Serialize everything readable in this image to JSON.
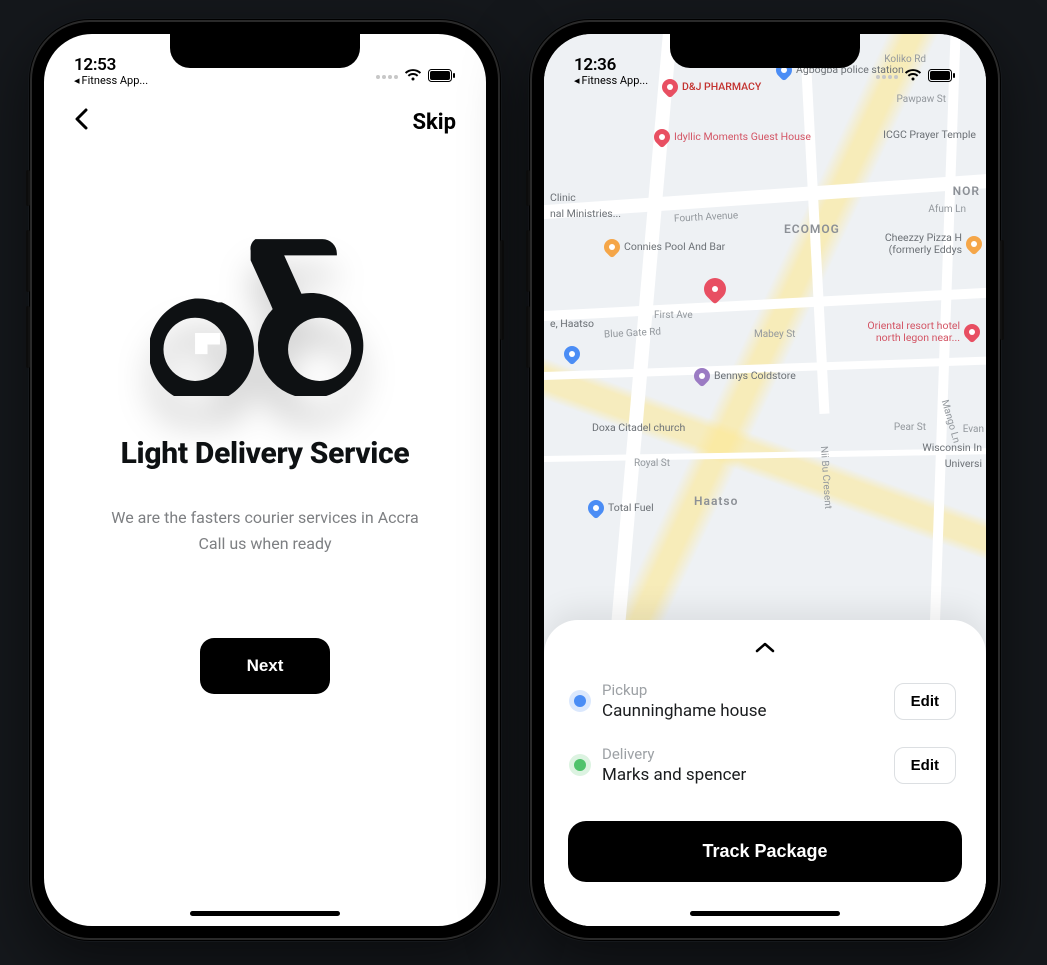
{
  "screen1": {
    "status": {
      "time": "12:53",
      "breadcrumb": "Fitness App..."
    },
    "nav": {
      "skip": "Skip"
    },
    "title": "Light Delivery Service",
    "subtitle_line1": "We are the fasters courier services in Accra",
    "subtitle_line2": "Call us when ready",
    "next": "Next"
  },
  "screen2": {
    "status": {
      "time": "12:36",
      "breadcrumb": "Fitness App..."
    },
    "map": {
      "area_labels": {
        "ecomog": "ECOMOG",
        "haatso": "Haatso",
        "nor": "NOR"
      },
      "road_labels": {
        "koliko": "Koliko Rd",
        "pawpaw": "Pawpaw St",
        "fourth": "Fourth Avenue",
        "first": "First Ave",
        "afum": "Afum Ln",
        "bluegate": "Blue Gate Rd",
        "mabey": "Mabey St",
        "pear": "Pear St",
        "royal": "Royal St",
        "nii": "Nii Bu Cresent",
        "mango": "Mango Ln",
        "evan": "Evan"
      },
      "pois": {
        "dj": "D&J PHARMACY",
        "agbogba": "Agbogba police station",
        "idyllic": "Idyllic Moments Guest House",
        "icgc": "ICGC Prayer Temple",
        "clinic": "Clinic",
        "ministries": "nal Ministries...",
        "connies": "Connies Pool And Bar",
        "cheezzy1": "Cheezzy Pizza H",
        "cheezzy2": "(formerly Eddys",
        "haatso_side": "e, Haatso",
        "oriental1": "Oriental resort hotel",
        "oriental2": "north legon near...",
        "bennys": "Bennys Coldstore",
        "doxa": "Doxa Citadel church",
        "wisconsin1": "Wisconsin In",
        "wisconsin2": "Universi",
        "total": "Total Fuel"
      }
    },
    "sheet": {
      "pickup_label": "Pickup",
      "pickup_value": "Caunninghame house",
      "delivery_label": "Delivery",
      "delivery_value": "Marks and spencer",
      "edit": "Edit",
      "track": "Track Package"
    }
  }
}
